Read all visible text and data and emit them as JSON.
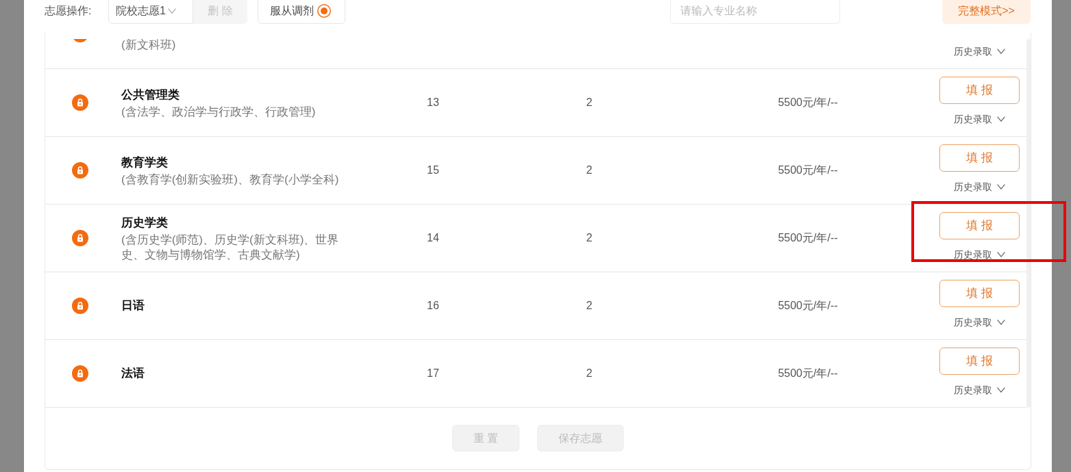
{
  "toolbar": {
    "label": "志愿操作:",
    "plan_select": {
      "value": "院校志愿1"
    },
    "delete_button": {
      "label": "删 除",
      "disabled": true
    },
    "adjust_option": {
      "label": "服从调剂",
      "selected": true
    },
    "search": {
      "placeholder": "请输入专业名称"
    },
    "mode_button": {
      "label": "完整模式>>"
    }
  },
  "table": {
    "clipped_row": {
      "description": "(新文科班)",
      "history_label": "历史录取"
    },
    "rows": [
      {
        "name": "公共管理类",
        "description": "(含法学、政治学与行政学、行政管理)",
        "column_2": "13",
        "column_3": "2",
        "fee": "5500元/年/--",
        "button": "填 报",
        "history_label": "历史录取",
        "highlighted": false
      },
      {
        "name": "教育学类",
        "description": "(含教育学(创新实验班)、教育学(小学全科)",
        "column_2": "15",
        "column_3": "2",
        "fee": "5500元/年/--",
        "button": "填 报",
        "history_label": "历史录取",
        "highlighted": false
      },
      {
        "name": "历史学类",
        "description": "(含历史学(师范)、历史学(新文科班)、世界史、文物与博物馆学、古典文献学)",
        "column_2": "14",
        "column_3": "2",
        "fee": "5500元/年/--",
        "button": "填 报",
        "history_label": "历史录取",
        "highlighted": true
      },
      {
        "name": "日语",
        "column_2": "16",
        "column_3": "2",
        "fee": "5500元/年/--",
        "button": "填 报",
        "history_label": "历史录取",
        "highlighted": false
      },
      {
        "name": "法语",
        "column_2": "17",
        "column_3": "2",
        "fee": "5500元/年/--",
        "button": "填 报",
        "history_label": "历史录取",
        "highlighted": false
      }
    ]
  },
  "footer": {
    "buttons": [
      {
        "label": "重 置",
        "disabled": true
      },
      {
        "label": "保存志愿",
        "disabled": true
      }
    ]
  }
}
